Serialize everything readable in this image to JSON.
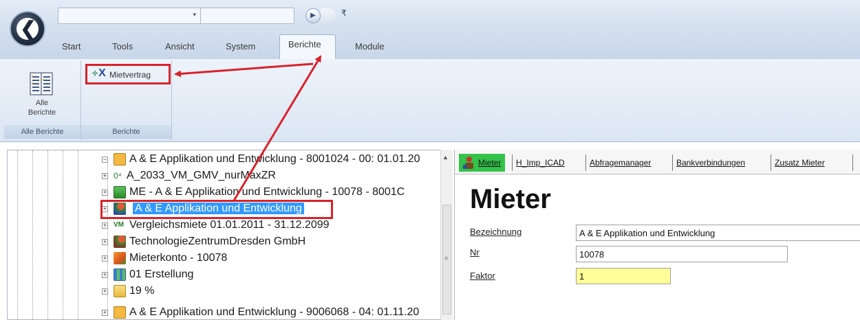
{
  "ribbon": {
    "tabs": [
      "Start",
      "Tools",
      "Ansicht",
      "System",
      "Berichte",
      "Module"
    ],
    "active_tab": "Berichte",
    "groups": [
      {
        "label": "Alle Berichte",
        "buttons": [
          {
            "label_line1": "Alle",
            "label_line2": "Berichte"
          }
        ]
      },
      {
        "label": "Berichte",
        "buttons": [
          {
            "label": "Mietvertrag"
          }
        ]
      }
    ]
  },
  "tree": {
    "items": [
      {
        "text": "A & E Applikation und Entwicklung - 8001024 - 00: 01.01.20",
        "level": 0,
        "icon": "building-icon"
      },
      {
        "text": "A_2033_VM_GMV_nurMaxZR",
        "level": 1,
        "icon": "document-number-icon"
      },
      {
        "text": "ME - A & E Applikation und Entwicklung - 10078 - 8001C",
        "level": 1,
        "icon": "rental-unit-icon"
      },
      {
        "text": "A & E Applikation und Entwicklung",
        "level": 1,
        "icon": "tenant-icon",
        "selected": true
      },
      {
        "text": "Vergleichsmiete 01.01.2011 - 31.12.2099",
        "level": 1,
        "icon": "rent-compare-icon"
      },
      {
        "text": "TechnologieZentrumDresden GmbH",
        "level": 1,
        "icon": "company-icon"
      },
      {
        "text": "Mieterkonto - 10078",
        "level": 1,
        "icon": "account-icon"
      },
      {
        "text": "01 Erstellung",
        "level": 1,
        "icon": "calendar-icon"
      },
      {
        "text": "19 %",
        "level": 1,
        "icon": "folder-tax-icon"
      },
      {
        "text": "A & E Applikation und Entwicklung - 9006068 - 04: 01.11.20",
        "level": 0,
        "icon": "building-icon"
      }
    ]
  },
  "detail": {
    "tabs": [
      "Mieter",
      "H_Imp_ICAD",
      "Abfragemanager",
      "Bankverbindungen",
      "Zusatz Mieter"
    ],
    "title": "Mieter",
    "fields": [
      {
        "label": "Bezeichnung",
        "value": "A & E Applikation und Entwicklung"
      },
      {
        "label": "Nr",
        "value": "10078"
      },
      {
        "label": "Faktor",
        "value": "1"
      }
    ]
  },
  "colors": {
    "highlight_frame": "#d9222a",
    "selection": "#3399ff",
    "active_detail_tab": "#33c24a",
    "faktor_field": "#ffff99"
  }
}
